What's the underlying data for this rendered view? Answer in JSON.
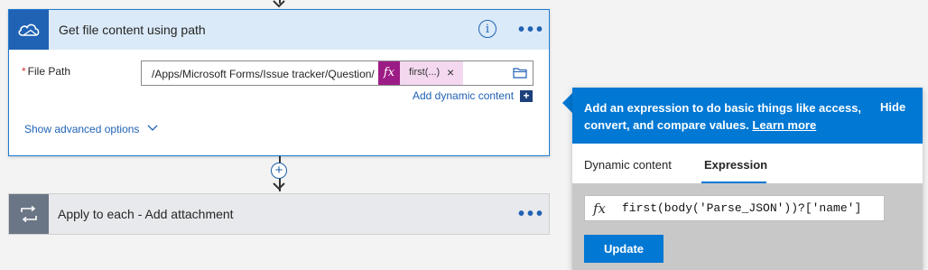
{
  "card1": {
    "title": "Get file content using path",
    "icon": "onedrive-cloud-icon",
    "info_icon": "info-icon",
    "more_label": "•••",
    "field": {
      "required_mark": "*",
      "label": "File Path",
      "path_value": "/Apps/Microsoft Forms/Issue tracker/Question/",
      "token": {
        "fx_label": "fx",
        "label": "first(...)",
        "close": "×"
      },
      "folder_icon": "folder-icon"
    },
    "add_dynamic_content": "Add dynamic content",
    "add_dynamic_plus": "+",
    "show_advanced": "Show advanced options"
  },
  "card2": {
    "title": "Apply to each - Add attachment",
    "icon": "loop-icon",
    "more_label": "•••"
  },
  "connector": {
    "plus": "+"
  },
  "popup": {
    "description": "Add an expression to do basic things like access, convert, and compare values.",
    "learn_more": "Learn more",
    "hide": "Hide",
    "tabs": [
      {
        "label": "Dynamic content",
        "active": false
      },
      {
        "label": "Expression",
        "active": true
      }
    ],
    "expression": {
      "fx_label": "fx",
      "value": "first(body('Parse_JSON'))?['name']"
    },
    "update_label": "Update"
  },
  "colors": {
    "accent": "#0078d4",
    "card_header": "#dbeaf8",
    "token_fx": "#9c1c86",
    "token_bg": "#f4d8f0"
  }
}
